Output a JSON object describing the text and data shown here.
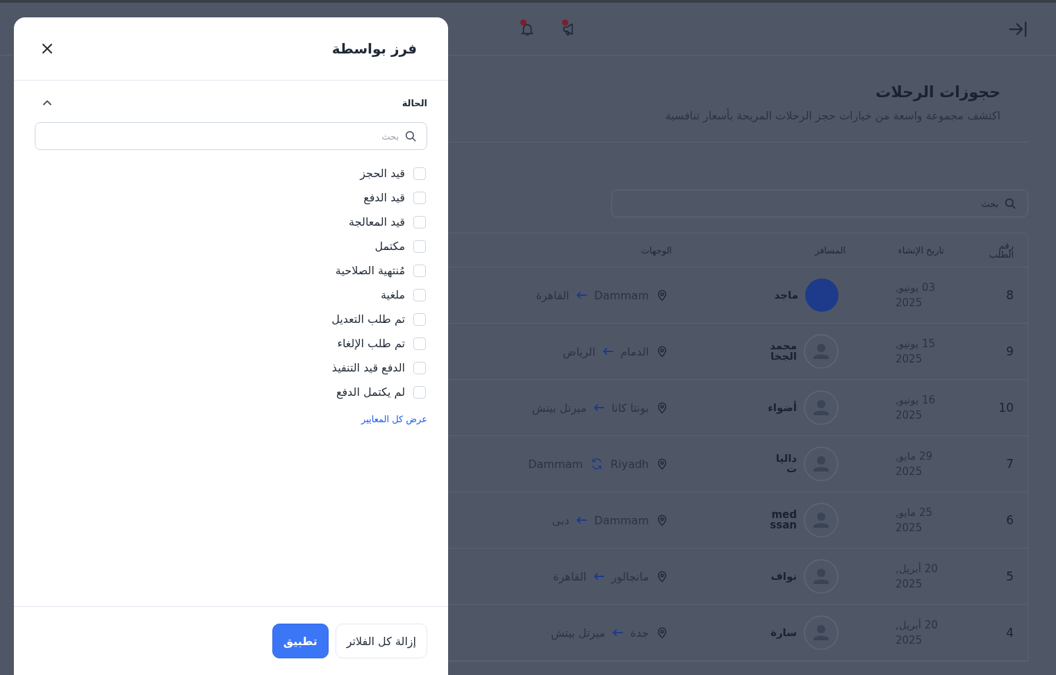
{
  "topbar": {
    "notifications": [
      {
        "kind": "megaphone",
        "unread": true
      },
      {
        "kind": "bell",
        "unread": true
      }
    ]
  },
  "page": {
    "title": "حجوزات الرحلات",
    "subtitle": "اكتشف مجموعة واسعة من خيارات حجز الرحلات المريحة بأسعار تنافسية"
  },
  "search": {
    "placeholder": "بحث"
  },
  "table": {
    "columns": [
      "رقم الطلب",
      "تاريخ الإنشاء",
      "المسافر",
      "الوجهات"
    ],
    "rows": [
      {
        "id": "8",
        "date": "03 يونيو, 2025",
        "passenger": {
          "name": "ماجد",
          "kind": "photo"
        },
        "route": {
          "from": "Dammam",
          "kind": "one_way",
          "to": "القاهرة"
        }
      },
      {
        "id": "9",
        "date": "15 يونيو, 2025",
        "passenger": {
          "name": "محمد الجخا",
          "kind": "default"
        },
        "route": {
          "from": "الدمام",
          "kind": "one_way",
          "to": "الرياض"
        }
      },
      {
        "id": "10",
        "date": "16 يونيو, 2025",
        "passenger": {
          "name": "أضواء",
          "kind": "default"
        },
        "route": {
          "from": "بونتا كانا",
          "kind": "one_way",
          "to": "ميرتل بيتش"
        }
      },
      {
        "id": "7",
        "date": "29 مايو, 2025",
        "passenger": {
          "name": "داليا ت",
          "kind": "default"
        },
        "route": {
          "from": "Riyadh",
          "kind": "round_trip",
          "to": "Dammam"
        }
      },
      {
        "id": "6",
        "date": "25 مايو, 2025",
        "passenger": {
          "name": "med ssan",
          "kind": "default"
        },
        "route": {
          "from": "Dammam",
          "kind": "one_way",
          "to": "دبى"
        }
      },
      {
        "id": "5",
        "date": "20 أبريل, 2025",
        "passenger": {
          "name": "نواف",
          "kind": "default"
        },
        "route": {
          "from": "مانجالور",
          "kind": "one_way",
          "to": "القاهرة"
        }
      },
      {
        "id": "4",
        "date": "20 أبريل, 2025",
        "passenger": {
          "name": "سارة",
          "kind": "default"
        },
        "route": {
          "from": "جدة",
          "kind": "one_way",
          "to": "ميرتل بيتش"
        }
      }
    ]
  },
  "drawer": {
    "title": "فرز بواسطة",
    "section": {
      "label": "الحالة",
      "expanded": true,
      "search_placeholder": "بحث",
      "options": [
        {
          "label": "قيد الحجز",
          "checked": false
        },
        {
          "label": "قيد الدفع",
          "checked": false
        },
        {
          "label": "قيد المعالجة",
          "checked": false
        },
        {
          "label": "مكتمل",
          "checked": false
        },
        {
          "label": "مُنتهية الصلاحية",
          "checked": false
        },
        {
          "label": "ملغية",
          "checked": false
        },
        {
          "label": "تم طلب التعديل",
          "checked": false
        },
        {
          "label": "تم طلب الإلغاء",
          "checked": false
        },
        {
          "label": "الدفع قيد التنفيذ",
          "checked": false
        },
        {
          "label": "لم يكتمل الدفع",
          "checked": false
        }
      ],
      "show_all_link": "عرض كل المعايير"
    },
    "clear_button": "إزالة كل الفلاتر",
    "apply_button": "تطبيق"
  }
}
